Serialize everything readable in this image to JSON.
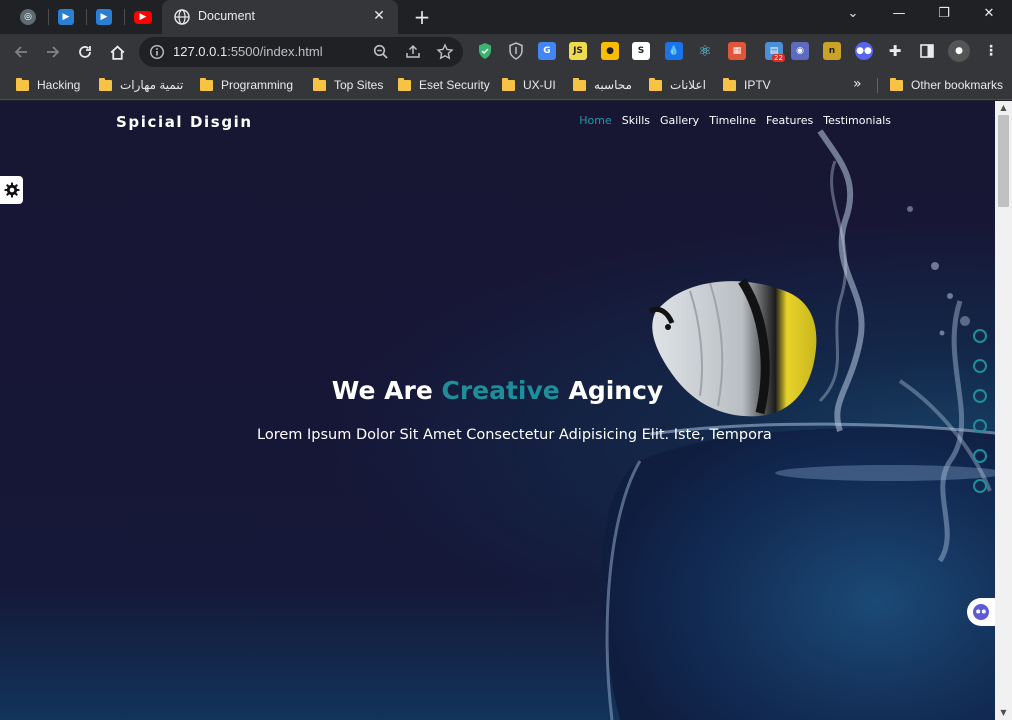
{
  "browser": {
    "active_tab": {
      "title": "Document"
    },
    "pinned_tabs": [
      "chatgpt-icon",
      "video-icon",
      "video-icon",
      "youtube-icon"
    ],
    "window_controls": {
      "minimize": "—",
      "maximize": "❐",
      "close": "✕"
    },
    "address": {
      "host": "127.0.0.1",
      "path": ":5500/index.html"
    },
    "extension_badge": "22"
  },
  "bookmarks": {
    "items": [
      "Hacking",
      "تنمية مهارات",
      "Programming",
      "Top Sites",
      "Eset Security",
      "UX-UI",
      "محاسبه",
      "اعلانات",
      "IPTV"
    ],
    "more": "»",
    "other": "Other bookmarks"
  },
  "site": {
    "logo": "Spicial Disgin",
    "nav": [
      "Home",
      "Skills",
      "Gallery",
      "Timeline",
      "Features",
      "Testimonials"
    ],
    "active_nav_index": 0,
    "hero": {
      "title_before": "We Are ",
      "title_accent": "Creative",
      "title_after": " Agincy",
      "subtitle": "Lorem Ipsum Dolor Sit Amet Consectetur Adipisicing Elit. Iste, Tempora"
    },
    "bullet_count": 6
  },
  "colors": {
    "accent": "#1f8e9a",
    "nav_active": "#2196a9",
    "page_bg": "#171733"
  }
}
